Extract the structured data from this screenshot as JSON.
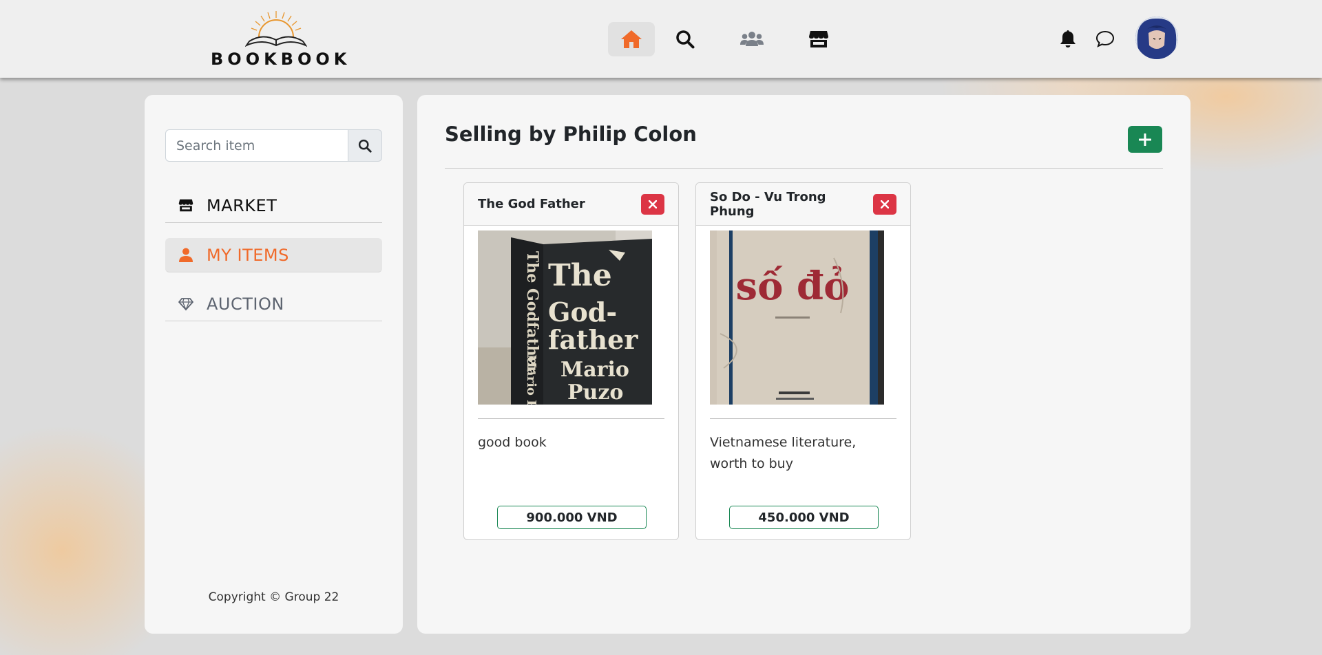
{
  "brand": {
    "name": "BOOKBOOK"
  },
  "nav": {
    "center": [
      {
        "icon": "home-icon",
        "active": true
      },
      {
        "icon": "search-icon",
        "active": false
      },
      {
        "icon": "users-icon",
        "active": false
      },
      {
        "icon": "store-icon",
        "active": false
      }
    ],
    "right": [
      {
        "icon": "bell-icon"
      },
      {
        "icon": "chat-icon"
      },
      {
        "icon": "avatar"
      }
    ]
  },
  "sidebar": {
    "search": {
      "placeholder": "Search item",
      "value": ""
    },
    "items": [
      {
        "label": "MARKET",
        "icon": "store-icon"
      },
      {
        "label": "MY ITEMS",
        "icon": "user-icon",
        "active": true
      },
      {
        "label": "AUCTION",
        "icon": "gem-icon"
      }
    ],
    "copyright": "Copyright © Group 22"
  },
  "main": {
    "title": "Selling by Philip Colon",
    "add_icon": "plus-icon",
    "cards": [
      {
        "title": "The God Father",
        "description": "good book",
        "price": "900.000 VND",
        "cover_text": "The Godfather Mario Puzo"
      },
      {
        "title": "So Do - Vu Trong Phung",
        "description": "Vietnamese literature, worth to buy",
        "price": "450.000 VND",
        "cover_text": "số đỏ"
      }
    ]
  },
  "colors": {
    "accent": "#f06a2a",
    "success": "#198754",
    "danger": "#dc3545",
    "panel": "#f6f6f6"
  }
}
